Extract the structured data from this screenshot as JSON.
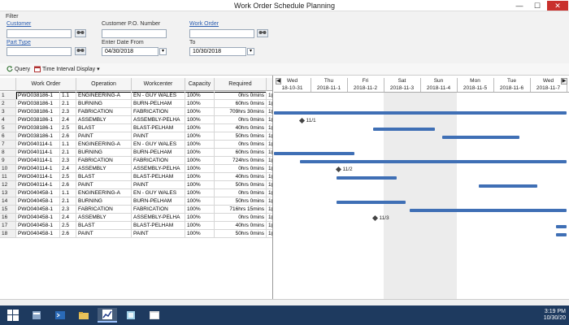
{
  "window": {
    "title": "Work Order Schedule Planning",
    "minimize": "—",
    "maximize": "☐",
    "close": "✕"
  },
  "filter": {
    "label": "Filter",
    "customer_label": "Customer",
    "customer_po_label": "Customer P.O. Number",
    "work_order_label": "Work Order",
    "part_type_label": "Part Type",
    "enter_date_from_label": "Enter Date From",
    "to_label": "To",
    "date_from": "04/30/2018",
    "date_to": "10/30/2018",
    "lookup_icon": "binoculars-icon",
    "dropdown_glyph": "▾"
  },
  "toolbar": {
    "query_label": "Query",
    "time_interval_label": "Time Interval Display",
    "dropdown_glyph": "▾"
  },
  "grid": {
    "columns": [
      "Work Order",
      "Operation",
      "Workcenter",
      "Capacity",
      "Required"
    ],
    "rows": [
      {
        "n": "1",
        "wo": "PWO038186-1",
        "seq": "1.1",
        "op": "ENGINEERING-A",
        "wc": "EN - GUY WALES",
        "cap": "100%",
        "req": "0hrs 0mins",
        "x": "1("
      },
      {
        "n": "2",
        "wo": "PWO038186-1",
        "seq": "2.1",
        "op": "BURNING",
        "wc": "BURN-PELHAM",
        "cap": "100%",
        "req": "60hrs 0mins",
        "x": "1("
      },
      {
        "n": "3",
        "wo": "PWO038186-1",
        "seq": "2.3",
        "op": "FABRICATION",
        "wc": "FABRICATION",
        "cap": "100%",
        "req": "709hrs 30mins",
        "x": "1("
      },
      {
        "n": "4",
        "wo": "PWO038186-1",
        "seq": "2.4",
        "op": "ASSEMBLY",
        "wc": "ASSEMBLY-PELHA",
        "cap": "100%",
        "req": "0hrs 0mins",
        "x": "1("
      },
      {
        "n": "5",
        "wo": "PWO038186-1",
        "seq": "2.5",
        "op": "BLAST",
        "wc": "BLAST-PELHAM",
        "cap": "100%",
        "req": "40hrs 0mins",
        "x": "1("
      },
      {
        "n": "6",
        "wo": "PWO038186-1",
        "seq": "2.6",
        "op": "PAINT",
        "wc": "PAINT",
        "cap": "100%",
        "req": "50hrs 0mins",
        "x": "1("
      },
      {
        "n": "7",
        "wo": "PWO040114-1",
        "seq": "1.1",
        "op": "ENGINEERING-A",
        "wc": "EN - GUY WALES",
        "cap": "100%",
        "req": "0hrs 0mins",
        "x": "1("
      },
      {
        "n": "8",
        "wo": "PWO040114-1",
        "seq": "2.1",
        "op": "BURNING",
        "wc": "BURN-PELHAM",
        "cap": "100%",
        "req": "60hrs 0mins",
        "x": "1("
      },
      {
        "n": "9",
        "wo": "PWO040114-1",
        "seq": "2.3",
        "op": "FABRICATION",
        "wc": "FABRICATION",
        "cap": "100%",
        "req": "724hrs 0mins",
        "x": "1("
      },
      {
        "n": "10",
        "wo": "PWO040114-1",
        "seq": "2.4",
        "op": "ASSEMBLY",
        "wc": "ASSEMBLY-PELHA",
        "cap": "100%",
        "req": "0hrs 0mins",
        "x": "1("
      },
      {
        "n": "11",
        "wo": "PWO040114-1",
        "seq": "2.5",
        "op": "BLAST",
        "wc": "BLAST-PELHAM",
        "cap": "100%",
        "req": "40hrs 0mins",
        "x": "1("
      },
      {
        "n": "12",
        "wo": "PWO040114-1",
        "seq": "2.6",
        "op": "PAINT",
        "wc": "PAINT",
        "cap": "100%",
        "req": "50hrs 0mins",
        "x": "1("
      },
      {
        "n": "13",
        "wo": "PWO040458-1",
        "seq": "1.1",
        "op": "ENGINEERING-A",
        "wc": "EN - GUY WALES",
        "cap": "100%",
        "req": "0hrs 0mins",
        "x": "1("
      },
      {
        "n": "14",
        "wo": "PWO040458-1",
        "seq": "2.1",
        "op": "BURNING",
        "wc": "BURN-PELHAM",
        "cap": "100%",
        "req": "50hrs 0mins",
        "x": "1("
      },
      {
        "n": "15",
        "wo": "PWO040458-1",
        "seq": "2.3",
        "op": "FABRICATION",
        "wc": "FABRICATION",
        "cap": "100%",
        "req": "716hrs 15mins",
        "x": "1("
      },
      {
        "n": "16",
        "wo": "PWO040458-1",
        "seq": "2.4",
        "op": "ASSEMBLY",
        "wc": "ASSEMBLY-PELHA",
        "cap": "100%",
        "req": "0hrs 0mins",
        "x": "1("
      },
      {
        "n": "17",
        "wo": "PWO040458-1",
        "seq": "2.5",
        "op": "BLAST",
        "wc": "BLAST-PELHAM",
        "cap": "100%",
        "req": "40hrs 0mins",
        "x": "1("
      },
      {
        "n": "18",
        "wo": "PWO040458-1",
        "seq": "2.6",
        "op": "PAINT",
        "wc": "PAINT",
        "cap": "100%",
        "req": "50hrs 0mins",
        "x": "1("
      }
    ]
  },
  "gantt": {
    "nav_prev": "◀",
    "nav_next": "▶",
    "days": [
      {
        "day": "Wed",
        "date": "18-10-31"
      },
      {
        "day": "Thu",
        "date": "2018-11-1"
      },
      {
        "day": "Fri",
        "date": "2018-11-2"
      },
      {
        "day": "Sat",
        "date": "2018-11-3"
      },
      {
        "day": "Sun",
        "date": "2018-11-4"
      },
      {
        "day": "Mon",
        "date": "2018-11-5"
      },
      {
        "day": "Tue",
        "date": "2018-11-6"
      },
      {
        "day": "Wed",
        "date": "2018-11-7"
      }
    ],
    "milestones": [
      {
        "row": 4,
        "day": 0.7,
        "label": "11/1"
      },
      {
        "row": 10,
        "day": 1.7,
        "label": "11/2"
      },
      {
        "row": 16,
        "day": 2.7,
        "label": "11/3"
      }
    ],
    "bars": [
      {
        "row": 3,
        "start": 0.0,
        "end": 8.0
      },
      {
        "row": 5,
        "start": 2.7,
        "end": 4.4
      },
      {
        "row": 6,
        "start": 4.6,
        "end": 6.7
      },
      {
        "row": 8,
        "start": 0.0,
        "end": 2.2
      },
      {
        "row": 9,
        "start": 0.7,
        "end": 8.0
      },
      {
        "row": 11,
        "start": 1.7,
        "end": 3.35
      },
      {
        "row": 12,
        "start": 5.6,
        "end": 7.2
      },
      {
        "row": 14,
        "start": 1.7,
        "end": 3.6
      },
      {
        "row": 15,
        "start": 3.7,
        "end": 8.0
      },
      {
        "row": 17,
        "start": 7.7,
        "end": 8.0
      },
      {
        "row": 18,
        "start": 7.7,
        "end": 8.0
      }
    ]
  },
  "taskbar": {
    "time": "3:19 PM",
    "date": "10/30/20"
  }
}
